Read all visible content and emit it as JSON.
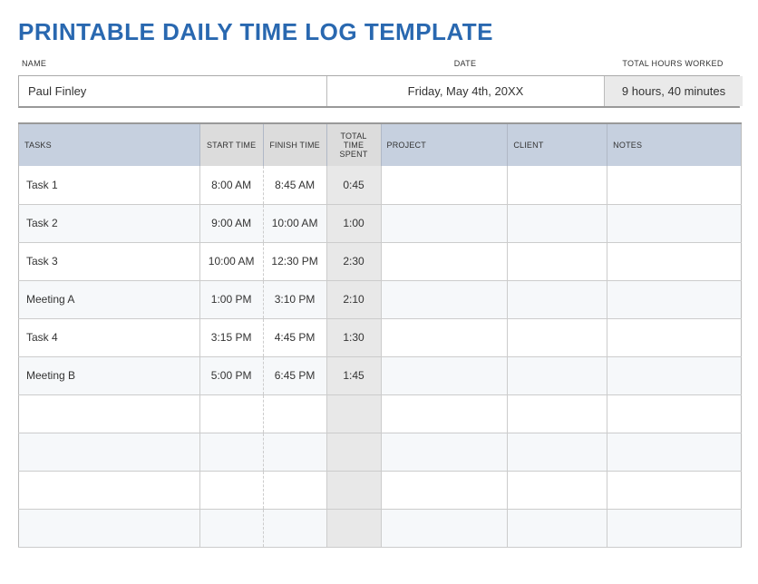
{
  "title": "PRINTABLE DAILY TIME LOG TEMPLATE",
  "meta": {
    "name_label": "NAME",
    "date_label": "DATE",
    "total_label": "TOTAL HOURS WORKED",
    "name": "Paul Finley",
    "date": "Friday, May 4th, 20XX",
    "total": "9 hours, 40 minutes"
  },
  "headers": {
    "tasks": "TASKS",
    "start": "START TIME",
    "finish": "FINISH TIME",
    "total": "TOTAL TIME SPENT",
    "project": "PROJECT",
    "client": "CLIENT",
    "notes": "NOTES"
  },
  "rows": [
    {
      "task": "Task 1",
      "start": "8:00 AM",
      "finish": "8:45 AM",
      "total": "0:45",
      "project": "",
      "client": "",
      "notes": ""
    },
    {
      "task": "Task 2",
      "start": "9:00 AM",
      "finish": "10:00 AM",
      "total": "1:00",
      "project": "",
      "client": "",
      "notes": ""
    },
    {
      "task": "Task 3",
      "start": "10:00 AM",
      "finish": "12:30 PM",
      "total": "2:30",
      "project": "",
      "client": "",
      "notes": ""
    },
    {
      "task": "Meeting A",
      "start": "1:00 PM",
      "finish": "3:10 PM",
      "total": "2:10",
      "project": "",
      "client": "",
      "notes": ""
    },
    {
      "task": "Task 4",
      "start": "3:15 PM",
      "finish": "4:45 PM",
      "total": "1:30",
      "project": "",
      "client": "",
      "notes": ""
    },
    {
      "task": "Meeting B",
      "start": "5:00 PM",
      "finish": "6:45 PM",
      "total": "1:45",
      "project": "",
      "client": "",
      "notes": ""
    },
    {
      "task": "",
      "start": "",
      "finish": "",
      "total": "",
      "project": "",
      "client": "",
      "notes": ""
    },
    {
      "task": "",
      "start": "",
      "finish": "",
      "total": "",
      "project": "",
      "client": "",
      "notes": ""
    },
    {
      "task": "",
      "start": "",
      "finish": "",
      "total": "",
      "project": "",
      "client": "",
      "notes": ""
    },
    {
      "task": "",
      "start": "",
      "finish": "",
      "total": "",
      "project": "",
      "client": "",
      "notes": ""
    }
  ]
}
